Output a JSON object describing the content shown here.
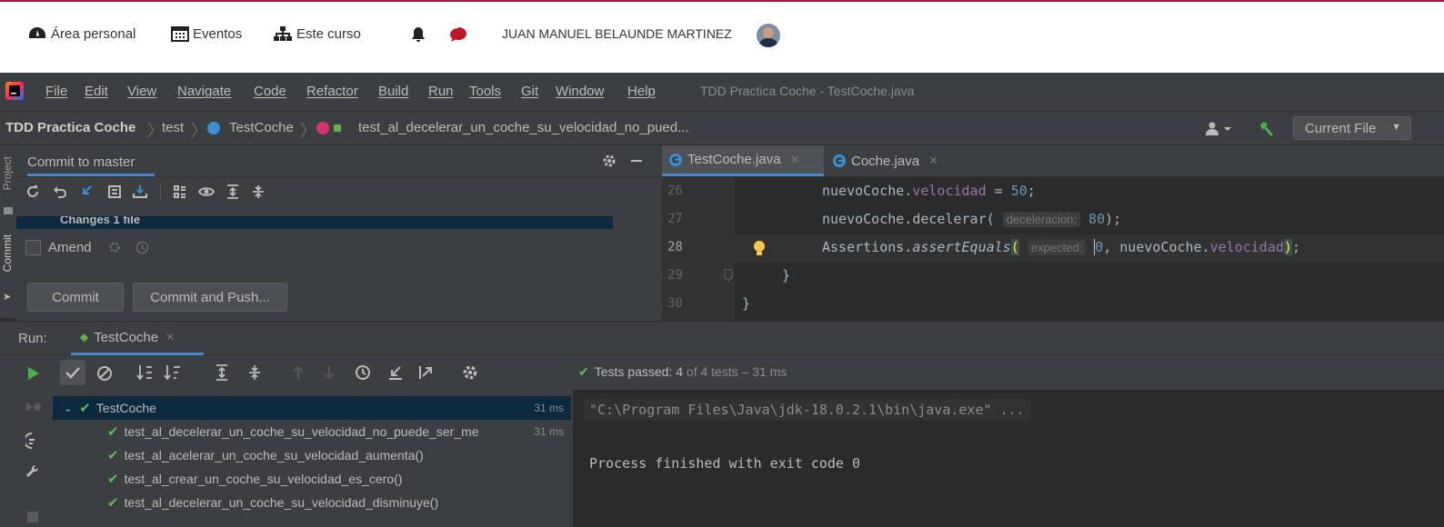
{
  "moodle": {
    "nav": [
      {
        "label": "Área personal",
        "icon": "dashboard-icon"
      },
      {
        "label": "Eventos",
        "icon": "calendar-icon"
      },
      {
        "label": "Este curso",
        "icon": "sitemap-icon"
      }
    ],
    "user_name": "JUAN MANUEL BELAUNDE MARTINEZ"
  },
  "ide": {
    "menu": [
      "File",
      "Edit",
      "View",
      "Navigate",
      "Code",
      "Refactor",
      "Build",
      "Run",
      "Tools",
      "Git",
      "Window",
      "Help"
    ],
    "window_title": "TDD Practica Coche - TestCoche.java",
    "breadcrumb": [
      "TDD Practica Coche",
      "test",
      "TestCoche",
      "test_al_decelerar_un_coche_su_velocidad_no_pued..."
    ],
    "run_config": "Current File",
    "side_tabs": [
      "Project",
      "Commit"
    ],
    "commit": {
      "title": "Commit to master",
      "changes_label": "Changes 1 file",
      "amend_label": "Amend",
      "commit_button": "Commit",
      "commit_push_button": "Commit and Push..."
    },
    "editor": {
      "tabs": [
        "TestCoche.java",
        "Coche.java"
      ],
      "lines": [
        {
          "num": "26",
          "obj": "nuevoCoche",
          "field": "velocidad",
          "value": "50"
        },
        {
          "num": "27",
          "obj": "nuevoCoche",
          "method": "decelerar",
          "hint": "deceleracion:",
          "value": "80"
        },
        {
          "num": "28",
          "cls": "Assertions",
          "method": "assertEquals",
          "hint": "expected:",
          "value": "0",
          "obj": "nuevoCoche",
          "field": "velocidad"
        },
        {
          "num": "29",
          "text": "}"
        },
        {
          "num": "30",
          "text": "}"
        }
      ]
    },
    "run": {
      "label": "Run:",
      "tab": "TestCoche",
      "status_strong": "Tests passed: 4",
      "status_rest": "of 4 tests – 31 ms",
      "tree": [
        {
          "name": "TestCoche",
          "duration": "31 ms"
        },
        {
          "name": "test_al_decelerar_un_coche_su_velocidad_no_puede_ser_me",
          "duration": "31 ms"
        },
        {
          "name": "test_al_acelerar_un_coche_su_velocidad_aumenta()",
          "duration": ""
        },
        {
          "name": "test_al_crear_un_coche_su_velocidad_es_cero()",
          "duration": ""
        },
        {
          "name": "test_al_decelerar_un_coche_su_velocidad_disminuye()",
          "duration": ""
        }
      ],
      "console": [
        "\"C:\\Program Files\\Java\\jdk-18.0.2.1\\bin\\java.exe\" ...",
        "Process finished with exit code 0"
      ]
    }
  },
  "colors": {
    "moodle_accent": "#9b1c3b",
    "ide_panel": "#3c3f41",
    "editor_bg": "#2b2b2b",
    "selection": "#0d293e",
    "pass_green": "#5fb85f",
    "field_purple": "#9876aa",
    "number_blue": "#6897bb"
  }
}
